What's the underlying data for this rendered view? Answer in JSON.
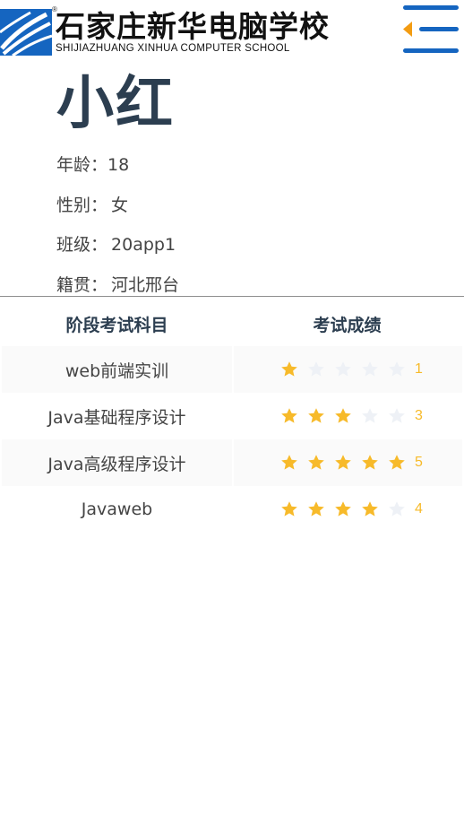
{
  "header": {
    "logo_cn": "石家庄新华电脑学校",
    "logo_en": "SHIJIAZHUANG XINHUA COMPUTER SCHOOL",
    "logo_mark": "®",
    "menu_icon": "menu-icon"
  },
  "student": {
    "name": "小红",
    "fields": [
      {
        "label": "年龄：",
        "value": "18"
      },
      {
        "label": "性别：",
        "value": "女"
      },
      {
        "label": "班级：",
        "value": "20app1"
      },
      {
        "label": "籍贯：",
        "value": "河北邢台"
      }
    ]
  },
  "table": {
    "headers": [
      "阶段考试科目",
      "考试成绩"
    ],
    "rows": [
      {
        "subject": "web前端实训",
        "score": 1,
        "score_text": "1"
      },
      {
        "subject": "Java基础程序设计",
        "score": 3,
        "score_text": "3"
      },
      {
        "subject": "Java高级程序设计",
        "score": 5,
        "score_text": "5"
      },
      {
        "subject": "Javaweb",
        "score": 4,
        "score_text": "4"
      }
    ],
    "max_stars": 5
  },
  "colors": {
    "star_on": "#f7ba2a",
    "star_off": "#eef1f6",
    "logo_blue": "#1565c0",
    "menu_blue": "#1565c0",
    "menu_arrow": "#f39c12"
  }
}
